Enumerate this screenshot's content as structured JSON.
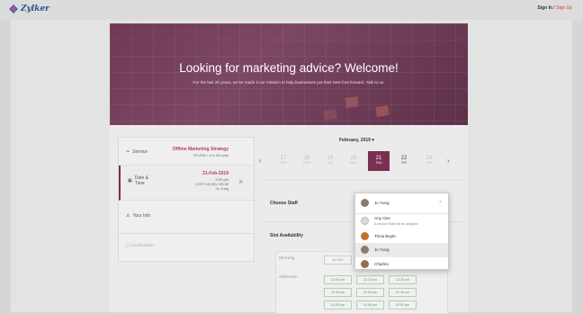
{
  "header": {
    "logo_text": "Zylker",
    "sign_in": "Sign In",
    "separator": "/",
    "sign_up": "Sign Up"
  },
  "hero": {
    "title": "Looking for marketing advice? Welcome!",
    "subtitle": "For the last 20 years, we've made it our mission to help businesses put their best foot forward. Talk to us."
  },
  "steps": {
    "service": {
      "label": "Service",
      "value": "Offline Marketing Strategy",
      "detail": "75 USD / 1 hr 30 mins"
    },
    "datetime": {
      "label_line1": "Date &",
      "label_line2": "Time",
      "date": "21-Feb-2019",
      "time": "9:00 pm",
      "timezone": "(GST+04:00) +05:30",
      "staff": "Jo Yung"
    },
    "info": {
      "label": "Your Info"
    },
    "confirmation": {
      "label": "Confirmation"
    }
  },
  "calendar": {
    "month": "February, 2019",
    "prev": "‹",
    "next": "›",
    "days": [
      {
        "d": "17",
        "w": "SUN"
      },
      {
        "d": "18",
        "w": "MON"
      },
      {
        "d": "19",
        "w": "TUE"
      },
      {
        "d": "20",
        "w": "WED"
      },
      {
        "d": "21",
        "w": "THU"
      },
      {
        "d": "22",
        "w": "FRI"
      },
      {
        "d": "23",
        "w": "SAT"
      }
    ]
  },
  "staff": {
    "label": "Choose Staff",
    "selected": "Jo Yung",
    "options": [
      {
        "name": "Any One",
        "sub": "A random Staff will be assigned"
      },
      {
        "name": "Tricia Boyle"
      },
      {
        "name": "Jo Yung"
      },
      {
        "name": "Charles"
      }
    ]
  },
  "slots": {
    "label": "Slot Availability",
    "morning": "Morning",
    "no_slot": "No Slot",
    "afternoon": "Afternoon",
    "times": [
      "12:00 pm",
      "12:15 pm",
      "12:30 pm",
      "12:45 pm",
      "01:00 pm",
      "01:15 pm",
      "01:30 pm",
      "01:45 pm",
      "02:00 pm"
    ]
  },
  "colors": {
    "brand": "#7b2f52",
    "accent": "#b73a6c",
    "slot": "#6b8f6c"
  },
  "icons": {
    "service": "scissors-icon",
    "datetime": "calendar-icon",
    "info": "user-icon",
    "confirm": "check-circle-icon"
  }
}
